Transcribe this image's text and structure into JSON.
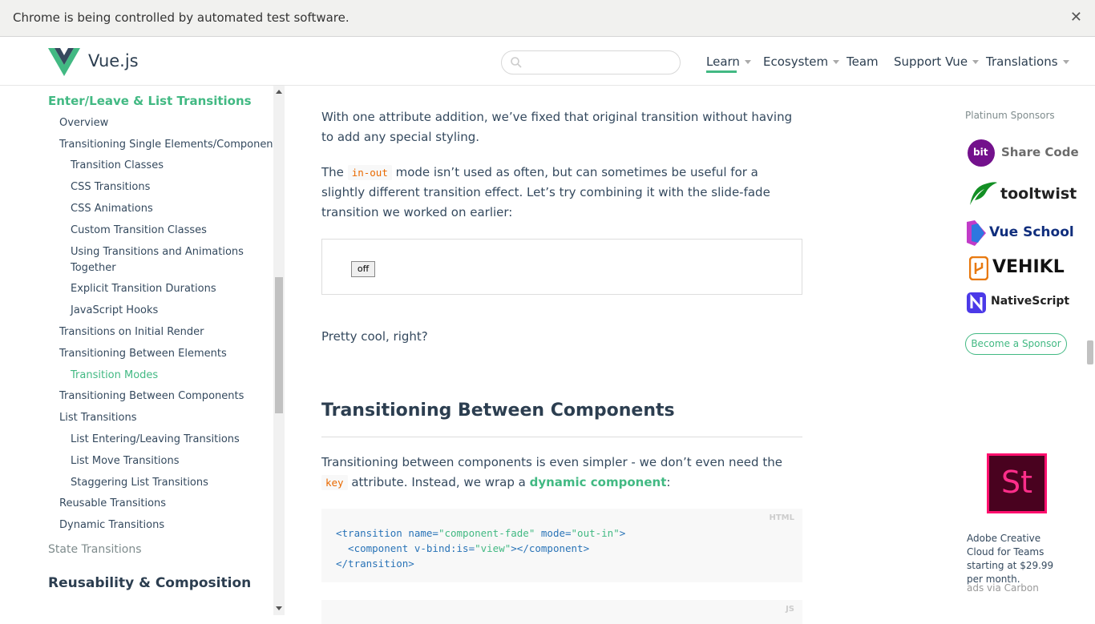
{
  "infobar": {
    "message": "Chrome is being controlled by automated test software.",
    "close": "✕"
  },
  "header": {
    "logo_text": "Vue.js",
    "search_placeholder": "",
    "nav": [
      {
        "label": "Learn",
        "dropdown": true,
        "active": true
      },
      {
        "label": "Ecosystem",
        "dropdown": true
      },
      {
        "label": "Team",
        "dropdown": false
      },
      {
        "label": "Support Vue",
        "dropdown": true
      },
      {
        "label": "Translations",
        "dropdown": true
      }
    ]
  },
  "sidebar": {
    "section_title": "Enter/Leave & List Transitions",
    "items": [
      "Overview",
      "Transitioning Single Elements/Components",
      "Transition Classes",
      "CSS Transitions",
      "CSS Animations",
      "Custom Transition Classes",
      "Using Transitions and Animations",
      "Together",
      "Explicit Transition Durations",
      "JavaScript Hooks",
      "Transitions on Initial Render",
      "Transitioning Between Elements",
      "Transition Modes",
      "Transitioning Between Components",
      "List Transitions",
      "List Entering/Leaving Transitions",
      "List Move Transitions",
      "Staggering List Transitions",
      "Reusable Transitions",
      "Dynamic Transitions"
    ],
    "state_transitions": "State Transitions",
    "reusability": "Reusability & Composition"
  },
  "content": {
    "p1": "With one attribute addition, we’ve fixed that original transition without having to add any special styling.",
    "p2_before": "The",
    "p2_code": "in-out",
    "p2_after": "mode isn’t used as often, but can sometimes be useful for a slightly different transition effect. Let’s try combining it with the slide-fade transition we worked on earlier:",
    "demo_button": "off",
    "p3": "Pretty cool, right?",
    "h2": "Transitioning Between Components",
    "p4_before": "Transitioning between components is even simpler - we don’t even need the",
    "p4_code": "key",
    "p4_mid": "attribute. Instead, we wrap a",
    "p4_link": "dynamic component",
    "p4_end": ":",
    "code_lang": "HTML",
    "code_lang2": "JS",
    "code": {
      "l1_tag_open": "<transition",
      "l1_attr1": " name=",
      "l1_val1": "\"component-fade\"",
      "l1_attr2": " mode=",
      "l1_val2": "\"out-in\"",
      "l1_close": ">",
      "l2_tag_open": "  <component",
      "l2_attr": " v-bind:is=",
      "l2_val": "\"view\"",
      "l2_close": "></component>",
      "l3": "</transition>"
    }
  },
  "sponsors": {
    "title": "Platinum Sponsors",
    "items": [
      "Share Code",
      "tooltwist",
      "Vue School",
      "VEHIKL",
      "NativeScript"
    ],
    "bit_label": "bit",
    "become": "Become a Sponsor"
  },
  "ad": {
    "image_text": "St",
    "text": "Adobe Creative Cloud for Teams starting at $29.99 per month.",
    "via": "ads via Carbon"
  },
  "colors": {
    "accent": "#42b983",
    "text": "#34495e",
    "heading": "#2c3e50"
  }
}
